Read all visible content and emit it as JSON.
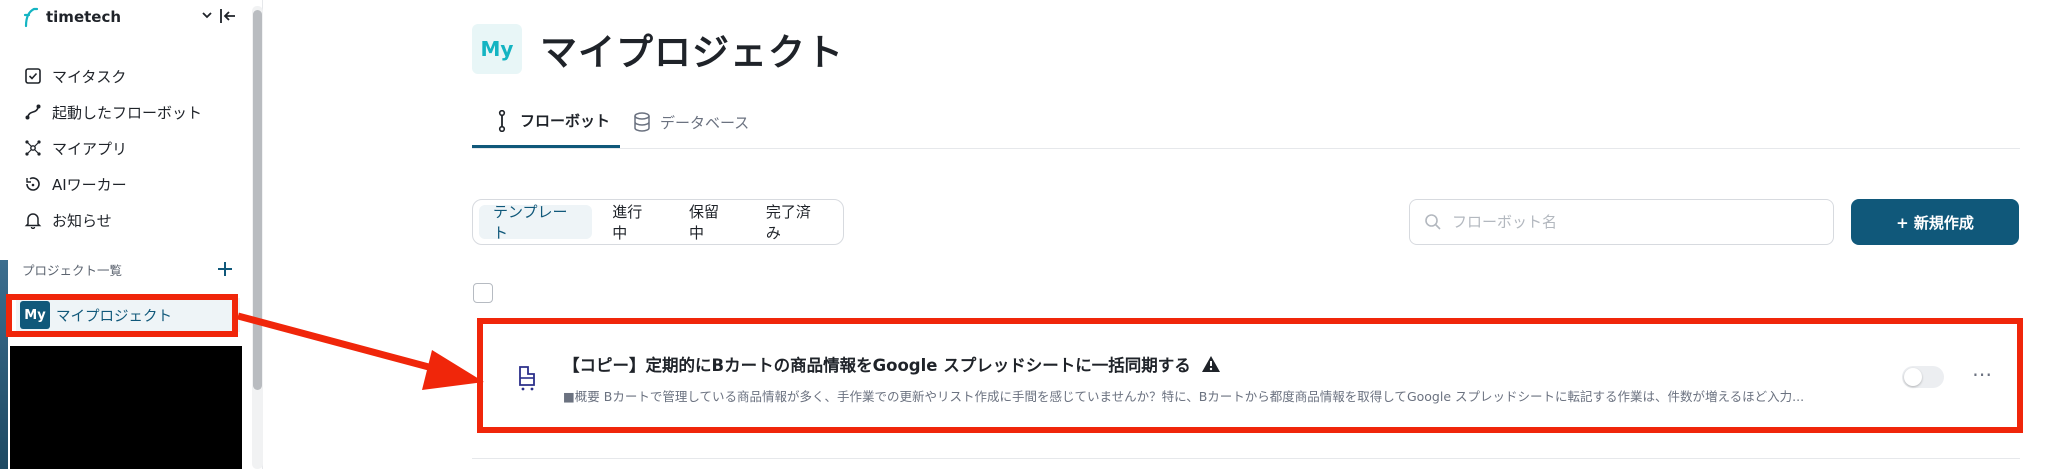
{
  "workspace": {
    "name": "timetech"
  },
  "sidebar": {
    "nav": [
      {
        "label": "マイタスク",
        "icon": "checkbox-icon"
      },
      {
        "label": "起動したフローボット",
        "icon": "flow-icon"
      },
      {
        "label": "マイアプリ",
        "icon": "apps-icon"
      },
      {
        "label": "AIワーカー",
        "icon": "ai-worker-icon"
      },
      {
        "label": "お知らせ",
        "icon": "bell-icon"
      }
    ],
    "projects_heading": "プロジェクト一覧",
    "project": {
      "avatar": "My",
      "label": "マイプロジェクト"
    }
  },
  "main": {
    "avatar": "My",
    "title": "マイプロジェクト",
    "tabs": [
      {
        "label": "フローボット",
        "active": true
      },
      {
        "label": "データベース",
        "active": false
      }
    ],
    "filters": [
      "テンプレート",
      "進行中",
      "保留中",
      "完了済み"
    ],
    "active_filter": "テンプレート",
    "search": {
      "placeholder": "フローボット名",
      "value": ""
    },
    "new_button": "+ 新規作成",
    "flow": {
      "title": "【コピー】定期的にBカートの商品情報をGoogle スプレッドシートに一括同期する",
      "description": "■概要 Bカートで管理している商品情報が多く、手作業での更新やリスト作成に手間を感じていませんか？特に、Bカートから都度商品情報を取得してGoogle スプレッドシートに転記する作業は、件数が増えるほど入力...",
      "enabled": false
    }
  },
  "colors": {
    "accent": "#10587a",
    "highlight": "#f0260a",
    "brand_teal": "#14b4c2"
  }
}
